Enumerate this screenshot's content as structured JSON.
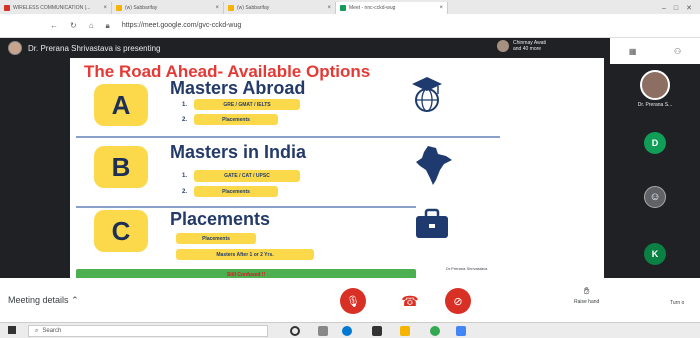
{
  "browser": {
    "tabs": [
      {
        "label": "WIRELESS COMMUNICATION (..."
      },
      {
        "label": "(w) Sabbarifay"
      },
      {
        "label": "(w) Sabbarifay"
      },
      {
        "label": "Meet - nnc-cckd-wug"
      }
    ],
    "url": "https://meet.google.com/gvc-cckd-wug"
  },
  "meet": {
    "presenter_text": "Dr. Prerana Shrivastava is presenting",
    "participants_chip": "Chinmay Awati and 40 more",
    "side_tiles": [
      {
        "label": "Dr. Prerana S...",
        "initial": "",
        "color": "#8d6e63"
      },
      {
        "label": "",
        "initial": "D",
        "color": "#0f9d58"
      },
      {
        "label": "",
        "initial": "",
        "color": "#5f6368"
      },
      {
        "label": "",
        "initial": "K",
        "color": "#0b8043"
      }
    ],
    "meeting_details": "Meeting details",
    "raise_hand": "Raise hand",
    "turn_on": "Turn o"
  },
  "slide": {
    "title": "The Road Ahead- Available Options",
    "sections": [
      {
        "letter": "A",
        "heading": "Masters Abroad",
        "items": [
          {
            "num": "1.",
            "text": "GRE / GMAT / IELTS"
          },
          {
            "num": "2.",
            "text": "Placements"
          }
        ]
      },
      {
        "letter": "B",
        "heading": "Masters in India",
        "items": [
          {
            "num": "1.",
            "text": "GATE / CAT / UPSC"
          },
          {
            "num": "2.",
            "text": "Placements"
          }
        ]
      },
      {
        "letter": "C",
        "heading": "Placements",
        "items": [
          {
            "num": "",
            "text": "Placements"
          },
          {
            "num": "",
            "text": "Masters After 1 or 2 Yrs."
          }
        ]
      }
    ],
    "footer_banner": "Still Confused !!",
    "credit": "Dr.Prerana Shrivastava"
  },
  "taskbar": {
    "search_placeholder": "Search"
  }
}
